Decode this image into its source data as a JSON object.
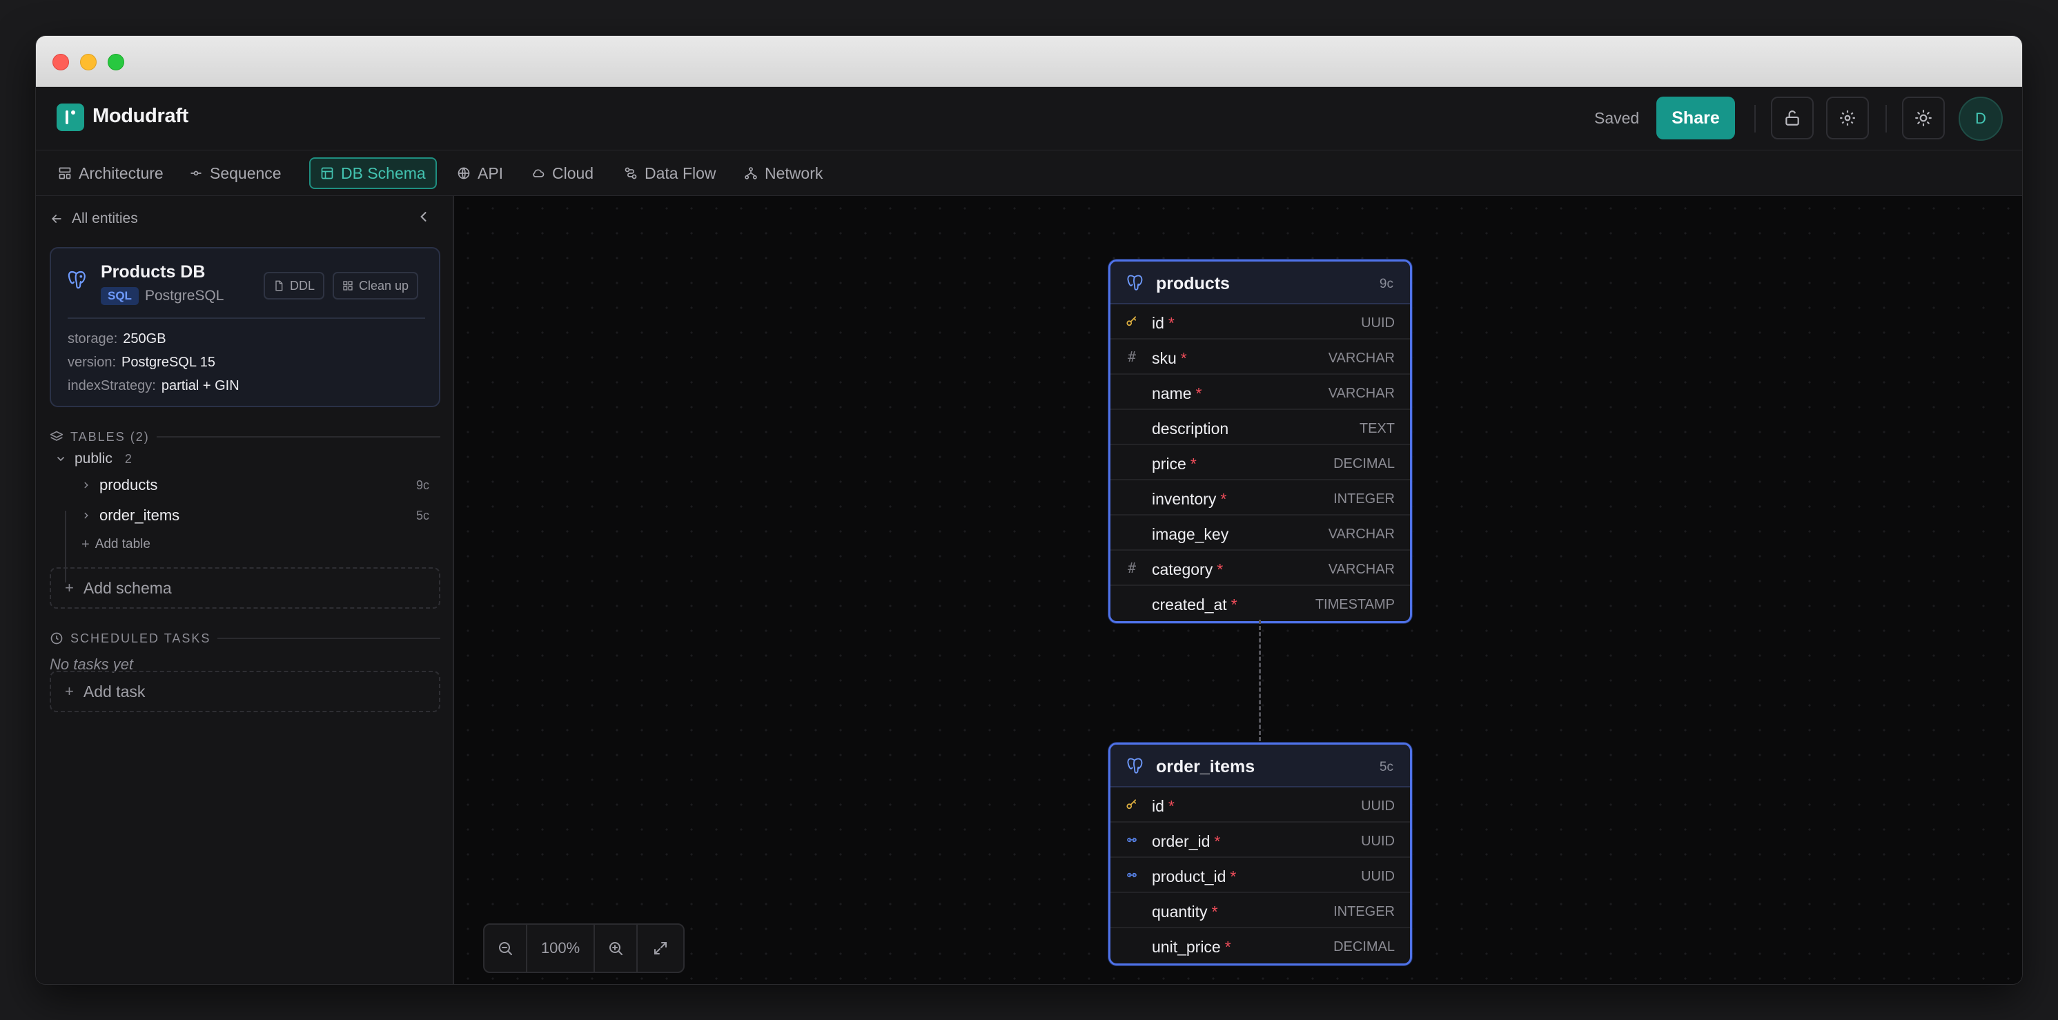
{
  "app": {
    "name": "Modudraft",
    "status": "Saved",
    "share_label": "Share",
    "avatar_initial": "D"
  },
  "tabs": [
    {
      "label": "Architecture",
      "icon": "layout-icon",
      "active": false
    },
    {
      "label": "Sequence",
      "icon": "commit-icon",
      "active": false
    },
    {
      "label": "DB Schema",
      "icon": "table-icon",
      "active": true
    },
    {
      "label": "API",
      "icon": "globe-icon",
      "active": false
    },
    {
      "label": "Cloud",
      "icon": "cloud-icon",
      "active": false
    },
    {
      "label": "Data Flow",
      "icon": "route-icon",
      "active": false
    },
    {
      "label": "Network",
      "icon": "network-icon",
      "active": false
    }
  ],
  "sidebar": {
    "back_label": "All entities",
    "db": {
      "name": "Products DB",
      "badge": "SQL",
      "engine": "PostgreSQL",
      "ddl_label": "DDL",
      "cleanup_label": "Clean up",
      "props": [
        {
          "key": "storage:",
          "value": "250GB"
        },
        {
          "key": "version:",
          "value": "PostgreSQL 15"
        },
        {
          "key": "indexStrategy:",
          "value": "partial + GIN"
        }
      ]
    },
    "tables_header": "TABLES (2)",
    "schema": {
      "name": "public",
      "count": "2"
    },
    "tables": [
      {
        "name": "products",
        "count": "9c"
      },
      {
        "name": "order_items",
        "count": "5c"
      }
    ],
    "add_table_label": "Add table",
    "add_schema_label": "Add schema",
    "tasks_header": "SCHEDULED TASKS",
    "no_tasks": "No tasks yet",
    "add_task_label": "Add task"
  },
  "canvas": {
    "zoom": "100%",
    "tables": [
      {
        "name": "products",
        "count": "9c",
        "columns": [
          {
            "name": "id",
            "type": "UUID",
            "required": "*",
            "icon": "key-icon"
          },
          {
            "name": "sku",
            "type": "VARCHAR",
            "required": "*",
            "icon": "hash-icon"
          },
          {
            "name": "name",
            "type": "VARCHAR",
            "required": "*",
            "icon": ""
          },
          {
            "name": "description",
            "type": "TEXT",
            "required": "",
            "icon": ""
          },
          {
            "name": "price",
            "type": "DECIMAL",
            "required": "*",
            "icon": ""
          },
          {
            "name": "inventory",
            "type": "INTEGER",
            "required": "*",
            "icon": ""
          },
          {
            "name": "image_key",
            "type": "VARCHAR",
            "required": "",
            "icon": ""
          },
          {
            "name": "category",
            "type": "VARCHAR",
            "required": "*",
            "icon": "hash-icon"
          },
          {
            "name": "created_at",
            "type": "TIMESTAMP",
            "required": "*",
            "icon": ""
          }
        ]
      },
      {
        "name": "order_items",
        "count": "5c",
        "columns": [
          {
            "name": "id",
            "type": "UUID",
            "required": "*",
            "icon": "key-icon"
          },
          {
            "name": "order_id",
            "type": "UUID",
            "required": "*",
            "icon": "link-icon"
          },
          {
            "name": "product_id",
            "type": "UUID",
            "required": "*",
            "icon": "link-icon"
          },
          {
            "name": "quantity",
            "type": "INTEGER",
            "required": "*",
            "icon": ""
          },
          {
            "name": "unit_price",
            "type": "DECIMAL",
            "required": "*",
            "icon": ""
          }
        ]
      }
    ]
  },
  "colors": {
    "accent": "#16968a",
    "table_border": "#4f72e8",
    "required": "#ef4d5a",
    "key": "#e3b341",
    "link": "#5a86f0"
  }
}
